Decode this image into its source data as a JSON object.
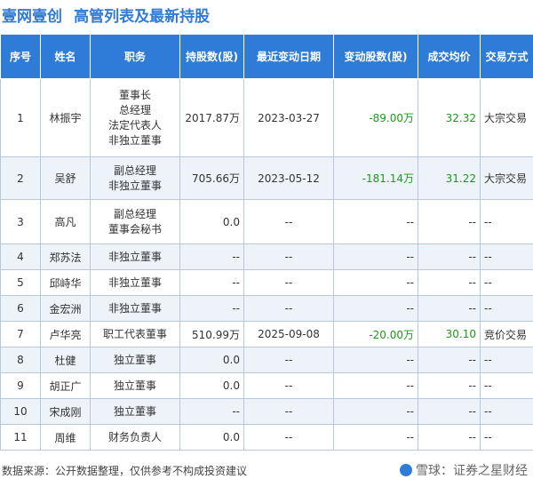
{
  "header": {
    "company": "壹网壹创",
    "title": "高管列表及最新持股"
  },
  "table": {
    "columns": [
      "序号",
      "姓名",
      "职务",
      "持股数(股)",
      "最近变动日期",
      "变动股数(股)",
      "成交均价",
      "交易方式"
    ],
    "rows": [
      {
        "no": "1",
        "name": "林振宇",
        "positions": [
          "董事长",
          "总经理",
          "法定代表人",
          "非独立董事"
        ],
        "shares": "2017.87万",
        "date": "2023-03-27",
        "change": "-89.00万",
        "price": "32.32",
        "method": "大宗交易"
      },
      {
        "no": "2",
        "name": "吴舒",
        "positions": [
          "副总经理",
          "非独立董事"
        ],
        "shares": "705.66万",
        "date": "2023-05-12",
        "change": "-181.14万",
        "price": "31.22",
        "method": "大宗交易"
      },
      {
        "no": "3",
        "name": "高凡",
        "positions": [
          "副总经理",
          "董事会秘书"
        ],
        "shares": "0.0",
        "date": "--",
        "change": "--",
        "price": "--",
        "method": "--"
      },
      {
        "no": "4",
        "name": "郑苏法",
        "positions": [
          "非独立董事"
        ],
        "shares": "--",
        "date": "--",
        "change": "--",
        "price": "--",
        "method": "--"
      },
      {
        "no": "5",
        "name": "邱峙华",
        "positions": [
          "非独立董事"
        ],
        "shares": "--",
        "date": "--",
        "change": "--",
        "price": "--",
        "method": "--"
      },
      {
        "no": "6",
        "name": "金宏洲",
        "positions": [
          "非独立董事"
        ],
        "shares": "--",
        "date": "--",
        "change": "--",
        "price": "--",
        "method": "--"
      },
      {
        "no": "7",
        "name": "卢华亮",
        "positions": [
          "职工代表董事"
        ],
        "shares": "510.99万",
        "date": "2025-09-08",
        "change": "-20.00万",
        "price": "30.10",
        "method": "竞价交易"
      },
      {
        "no": "8",
        "name": "杜健",
        "positions": [
          "独立董事"
        ],
        "shares": "0.0",
        "date": "--",
        "change": "--",
        "price": "--",
        "method": "--"
      },
      {
        "no": "9",
        "name": "胡正广",
        "positions": [
          "独立董事"
        ],
        "shares": "0.0",
        "date": "--",
        "change": "--",
        "price": "--",
        "method": "--"
      },
      {
        "no": "10",
        "name": "宋成刚",
        "positions": [
          "独立董事"
        ],
        "shares": "--",
        "date": "--",
        "change": "--",
        "price": "--",
        "method": "--"
      },
      {
        "no": "11",
        "name": "周维",
        "positions": [
          "财务负责人"
        ],
        "shares": "0.0",
        "date": "--",
        "change": "--",
        "price": "--",
        "method": "--"
      }
    ]
  },
  "footer": {
    "source": "数据来源：公开数据整理，仅供参考不构成投资建议",
    "brand": "雪球：证券之星财经"
  },
  "watermark": "证券之星",
  "colors": {
    "accent": "#2f7bd8",
    "change": "#1a9a1a"
  }
}
